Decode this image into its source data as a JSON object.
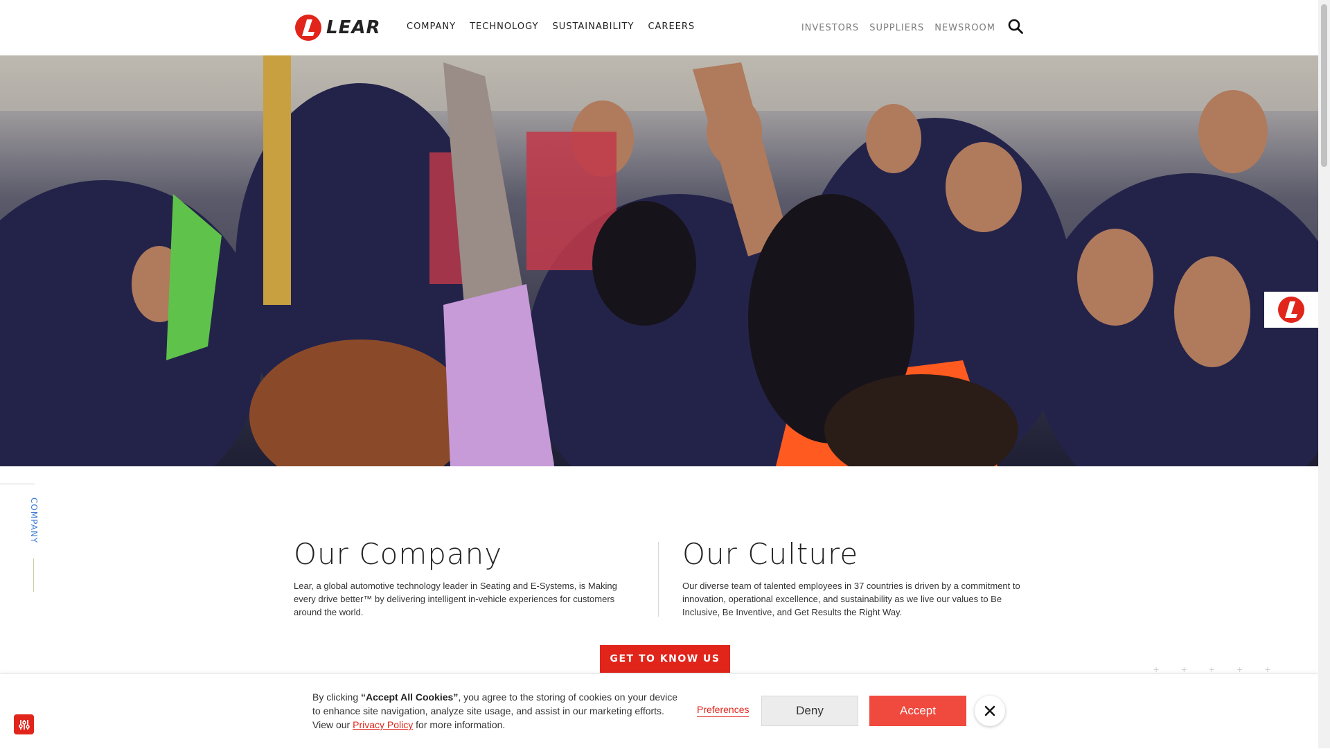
{
  "brand": {
    "name": "LEAR",
    "accent": "#e1251b"
  },
  "nav": {
    "main": [
      "COMPANY",
      "TECHNOLOGY",
      "SUSTAINABILITY",
      "CAREERS"
    ],
    "utility": [
      "INVESTORS",
      "SUPPLIERS",
      "NEWSROOM"
    ],
    "search_icon": "search-icon"
  },
  "hero": {
    "image_alt": "Team of employees in uniforms celebrating together"
  },
  "side_label": "COMPANY",
  "company": {
    "title": "Our Company",
    "text": "Lear, a global automotive technology leader in Seating and E-Systems, is Making every drive better™ by delivering intelligent in-vehicle experiences for customers around the world."
  },
  "culture": {
    "title": "Our Culture",
    "text": "Our diverse team of talented employees in 37 countries is driven by a commitment to innovation, operational excellence, and sustainability as we live our values to Be Inclusive, Be Inventive, and Get Results the Right Way."
  },
  "cta": {
    "label": "GET TO KNOW US"
  },
  "cookie": {
    "text_prefix": "By clicking ",
    "text_bold": "“Accept All Cookies”",
    "text_middle": ", you agree to the storing of cookies on your device to enhance site navigation, analyze site usage, and assist in our marketing efforts. View our ",
    "privacy_link": "Privacy Policy",
    "text_suffix": " for more information.",
    "preferences": "Preferences",
    "deny": "Deny",
    "accept": "Accept",
    "close_icon": "close-icon",
    "settings_icon": "sliders-icon"
  }
}
